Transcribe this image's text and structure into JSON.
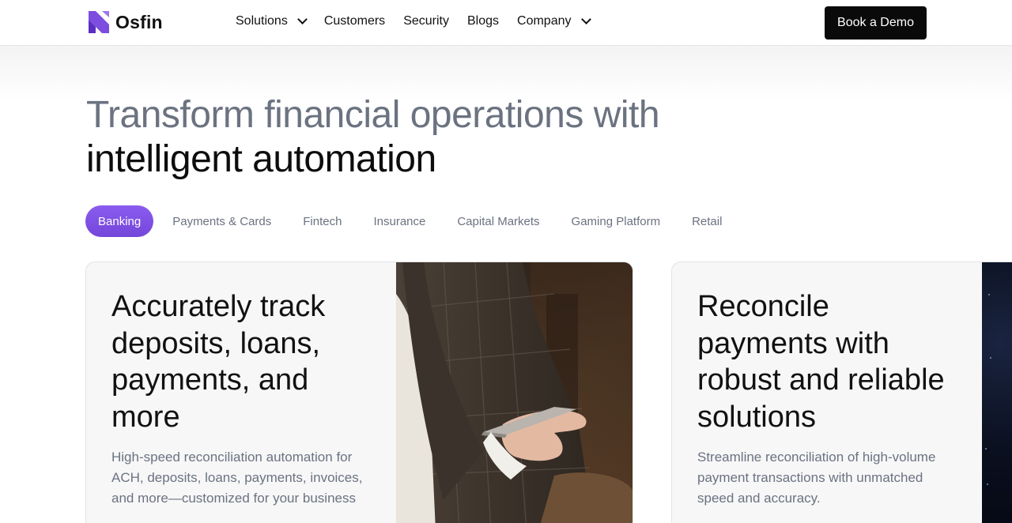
{
  "header": {
    "logo_text": "Osfin",
    "nav": [
      {
        "label": "Solutions",
        "dropdown": true
      },
      {
        "label": "Customers",
        "dropdown": false
      },
      {
        "label": "Security",
        "dropdown": false
      },
      {
        "label": "Blogs",
        "dropdown": false
      },
      {
        "label": "Company",
        "dropdown": true
      }
    ],
    "cta_label": "Book a Demo"
  },
  "hero": {
    "title_line1": "Transform financial operations with",
    "title_line2": "intelligent automation"
  },
  "tabs": [
    {
      "label": "Banking",
      "active": true
    },
    {
      "label": "Payments & Cards",
      "active": false
    },
    {
      "label": "Fintech",
      "active": false
    },
    {
      "label": "Insurance",
      "active": false
    },
    {
      "label": "Capital Markets",
      "active": false
    },
    {
      "label": "Gaming Platform",
      "active": false
    },
    {
      "label": "Retail",
      "active": false
    }
  ],
  "cards": [
    {
      "title": "Accurately track deposits, loans, payments, and more",
      "description": "High-speed reconciliation automation for ACH, deposits, loans, payments, invoices, and more—customized for your business",
      "image": "person-holding-card-photo"
    },
    {
      "title": "Reconcile payments with robust and reliable solutions",
      "description": "Streamline reconciliation of high-volume payment transactions with unmatched speed and accuracy.",
      "image": "night-sky-photo"
    }
  ],
  "colors": {
    "accent": "#7c4ddf",
    "cta_bg": "#0a0a0a",
    "muted_text": "#6b7280",
    "card_bg": "#f7f7f8"
  }
}
